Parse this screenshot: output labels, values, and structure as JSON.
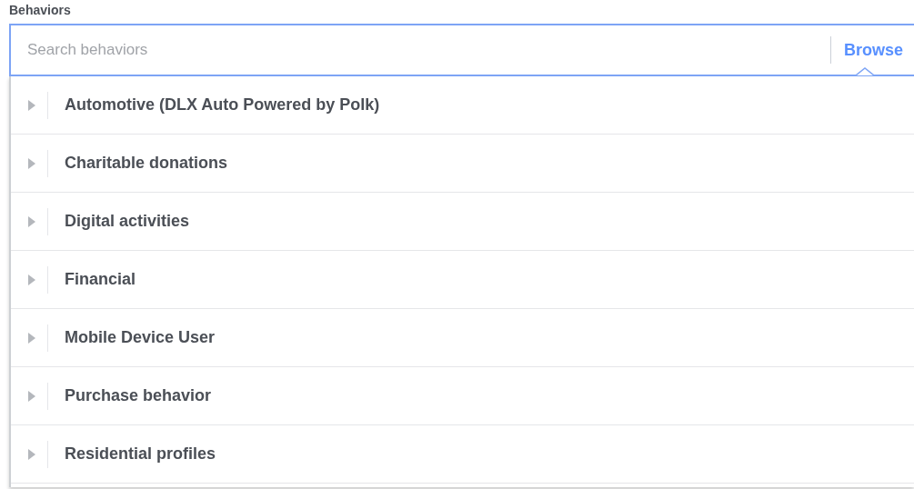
{
  "label": "Behaviors",
  "search": {
    "placeholder": "Search behaviors",
    "browse": "Browse"
  },
  "categories": [
    {
      "label": "Automotive (DLX Auto Powered by Polk)",
      "expanded": false
    },
    {
      "label": "Charitable donations",
      "expanded": false
    },
    {
      "label": "Digital activities",
      "expanded": false
    },
    {
      "label": "Financial",
      "expanded": false
    },
    {
      "label": "Mobile Device User",
      "expanded": false
    },
    {
      "label": "Purchase behavior",
      "expanded": false
    },
    {
      "label": "Residential profiles",
      "expanded": false
    }
  ]
}
